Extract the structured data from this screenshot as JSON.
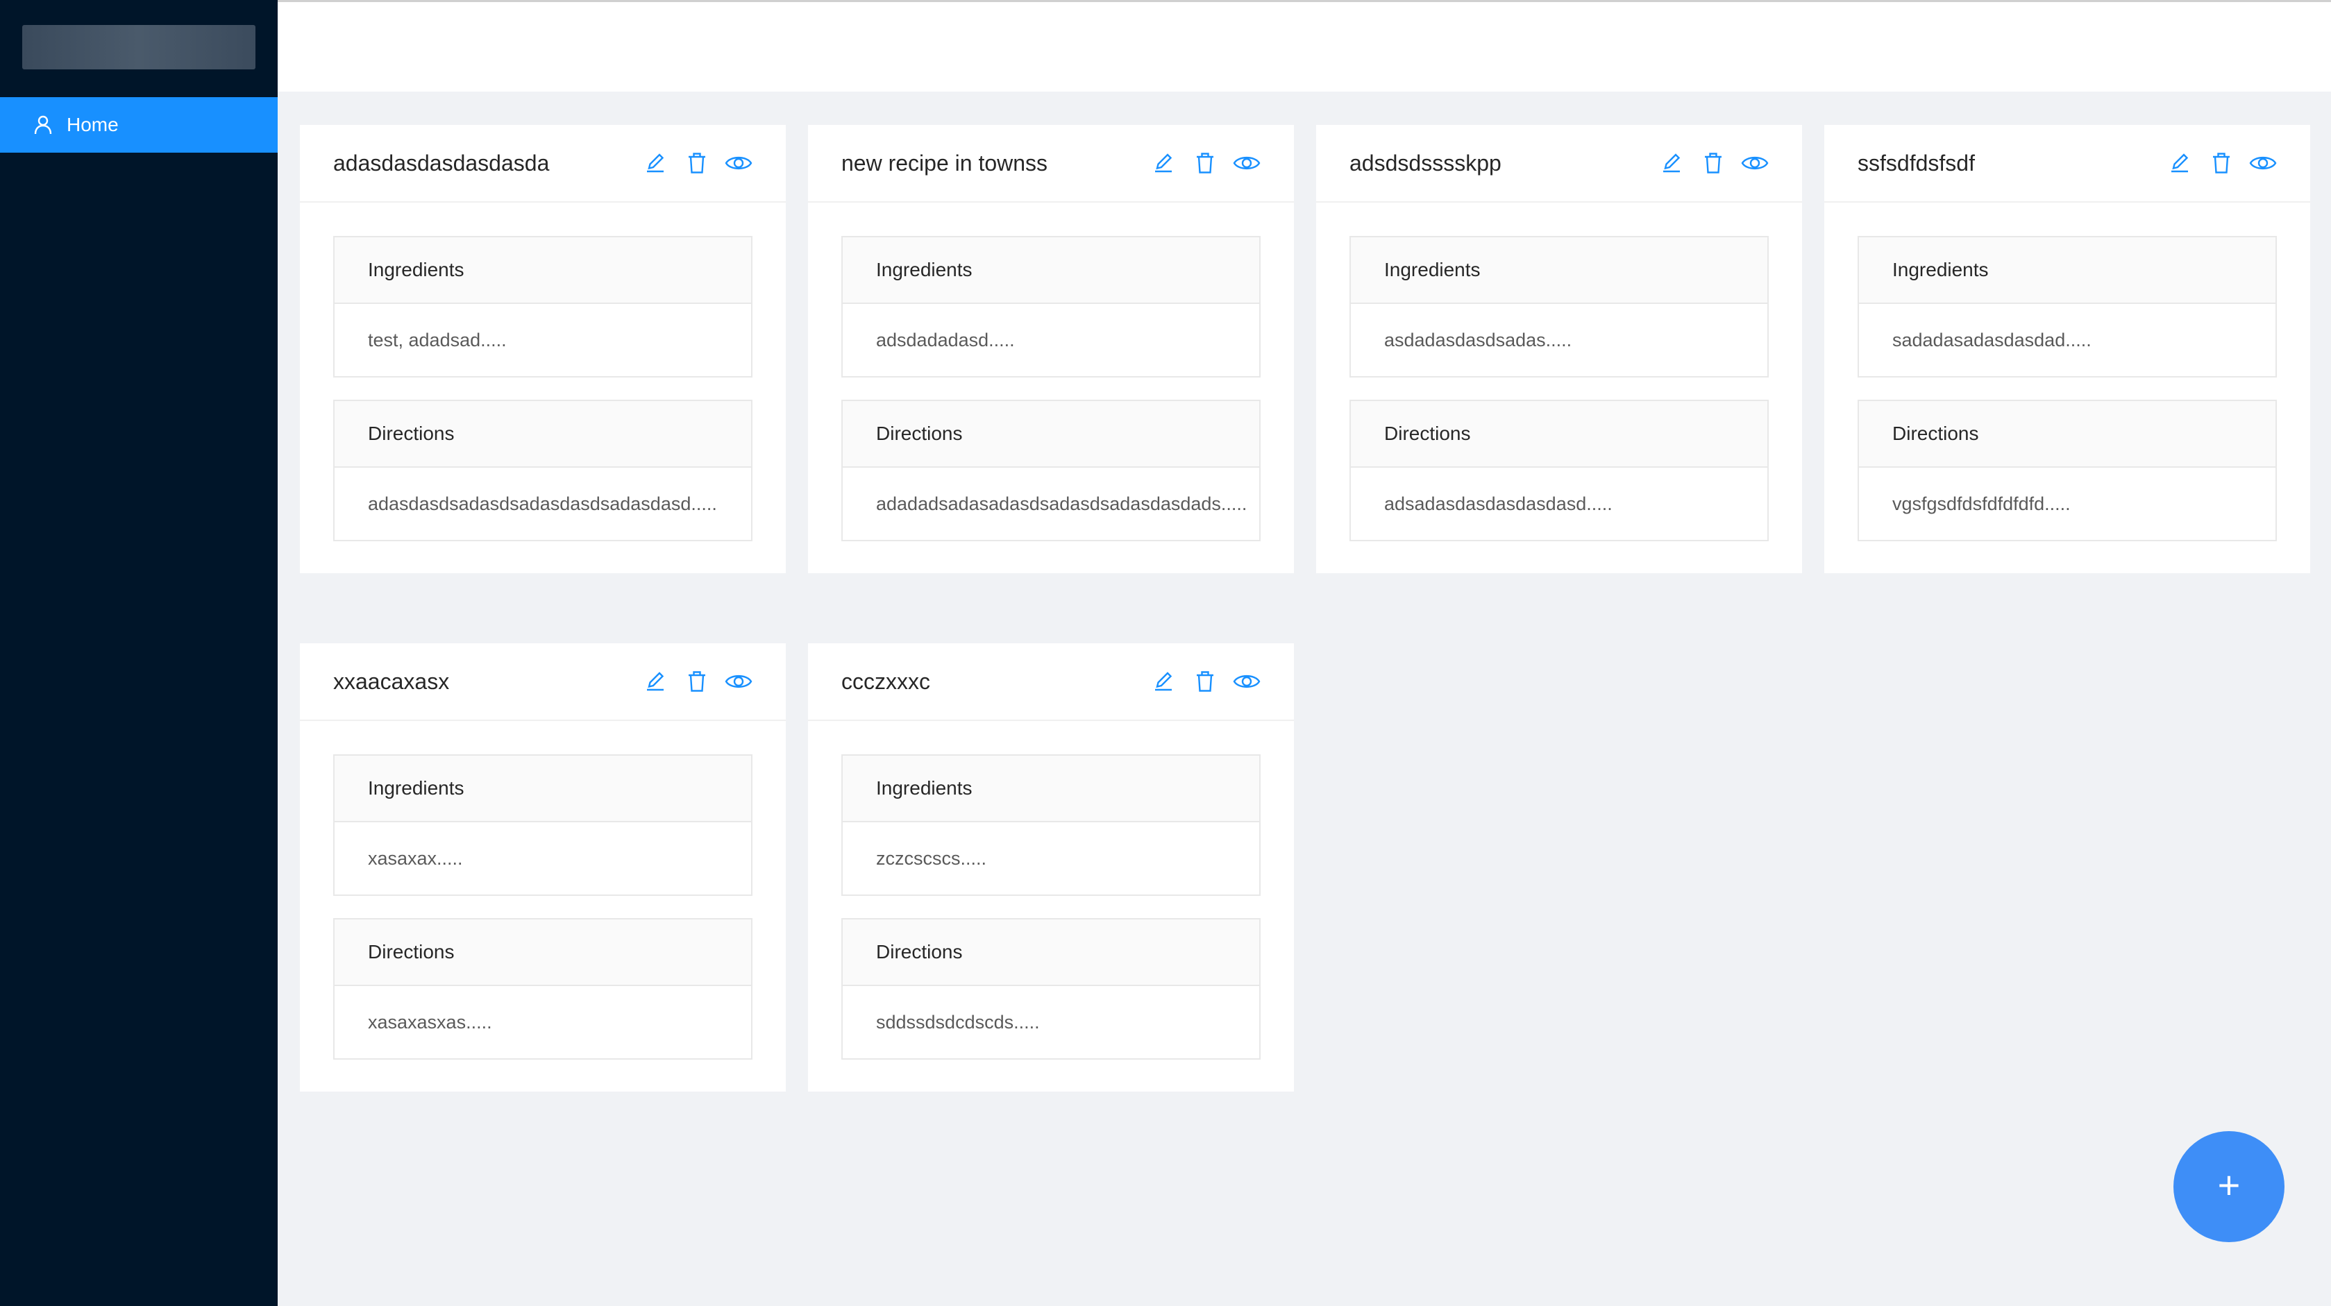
{
  "sidebar": {
    "items": [
      {
        "label": "Home",
        "icon": "user-icon"
      }
    ]
  },
  "fab": {
    "label": "+"
  },
  "colors": {
    "accent": "#1890ff",
    "sidebar_bg": "#001529",
    "fab_bg": "#3e8ef7",
    "icon": "#1890ff"
  },
  "recipes": [
    {
      "title": "adasdasdasdasdasda",
      "ingredients_label": "Ingredients",
      "ingredients": "test, adadsad.....",
      "directions_label": "Directions",
      "directions": "adasdasdsadasdsadasdasdsadasdasd....."
    },
    {
      "title": "new recipe in townss",
      "ingredients_label": "Ingredients",
      "ingredients": "adsdadadasd.....",
      "directions_label": "Directions",
      "directions": "adadadsadasadasdsadasdsadasdasdads....."
    },
    {
      "title": "adsdsdsssskpp",
      "ingredients_label": "Ingredients",
      "ingredients": "asdadasdasdsadas.....",
      "directions_label": "Directions",
      "directions": "adsadasdasdasdasdasd....."
    },
    {
      "title": "ssfsdfdsfsdf",
      "ingredients_label": "Ingredients",
      "ingredients": "sadadasadasdasdad.....",
      "directions_label": "Directions",
      "directions": "vgsfgsdfdsfdfdfdfd....."
    },
    {
      "title": "xxaacaxasx",
      "ingredients_label": "Ingredients",
      "ingredients": "xasaxax.....",
      "directions_label": "Directions",
      "directions": "xasaxasxas....."
    },
    {
      "title": "ccczxxxc",
      "ingredients_label": "Ingredients",
      "ingredients": "zczcscscs.....",
      "directions_label": "Directions",
      "directions": "sddssdsdcdscds....."
    }
  ]
}
